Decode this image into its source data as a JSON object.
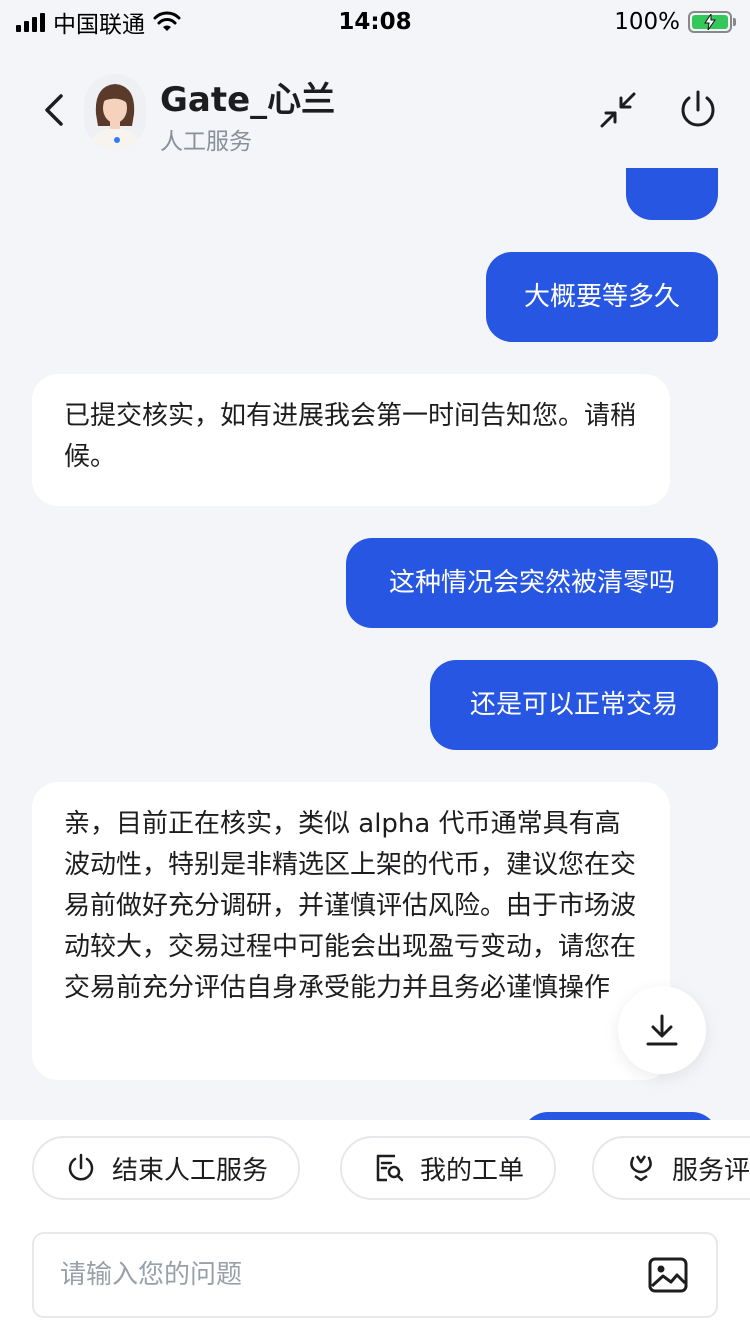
{
  "status_bar": {
    "carrier": "中国联通",
    "time": "14:08",
    "battery": "100%"
  },
  "header": {
    "agent_name": "Gate_心兰",
    "agent_status": "人工服务",
    "back_icon": "chevron-left-icon",
    "minimize_icon": "minimize-arrows-icon",
    "power_icon": "power-icon"
  },
  "messages": [
    {
      "role": "user",
      "text": "大概要等多久"
    },
    {
      "role": "agent",
      "text": "已提交核实，如有进展我会第一时间告知您。请稍候。"
    },
    {
      "role": "user",
      "text": "这种情况会突然被清零吗"
    },
    {
      "role": "user",
      "text": "还是可以正常交易"
    },
    {
      "role": "agent",
      "text": "亲，目前正在核实，类似 alpha 代币通常具有高波动性，特别是非精选区上架的代币，建议您在交易前做好充分调研，并谨慎评估风险。由于市场波动较大，交易过程中可能会出现盈亏变动，请您在交易前充分评估自身承受能力并且务必谨慎操作"
    }
  ],
  "quick_actions": [
    {
      "label": "结束人工服务",
      "icon": "power-icon"
    },
    {
      "label": "我的工单",
      "icon": "ticket-search-icon"
    },
    {
      "label": "服务评",
      "icon": "rating-icon"
    }
  ],
  "input": {
    "placeholder": "请输入您的问题",
    "value": ""
  },
  "colors": {
    "accent": "#2656e2",
    "background": "#f3f5f8"
  }
}
